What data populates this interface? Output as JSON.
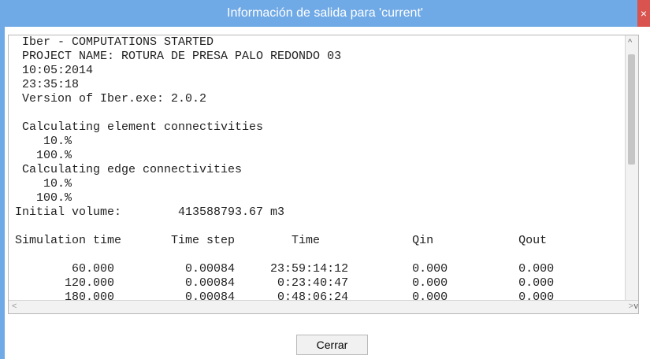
{
  "window": {
    "title": "Información de salida para 'current'",
    "close_label": "×"
  },
  "console": {
    "lines": [
      " Iber - COMPUTATIONS STARTED",
      " PROJECT NAME: ROTURA DE PRESA PALO REDONDO 03",
      " 10:05:2014",
      " 23:35:18",
      " Version of Iber.exe: 2.0.2",
      "",
      " Calculating element connectivities",
      "    10.%",
      "   100.%",
      " Calculating edge connectivities",
      "    10.%",
      "   100.%",
      "Initial volume:        413588793.67 m3",
      "",
      "Simulation time       Time step        Time             Qin            Qout",
      "",
      "        60.000          0.00084     23:59:14:12         0.000          0.000",
      "       120.000          0.00084      0:23:40:47         0.000          0.000",
      "       180.000          0.00084      0:48:06:24         0.000          0.000"
    ]
  },
  "scroll": {
    "up": "^",
    "left": "<",
    "right": ">",
    "down": "v"
  },
  "buttons": {
    "close_label": "Cerrar"
  },
  "colors": {
    "titlebar": "#6fa9e6",
    "close": "#d9534f"
  }
}
